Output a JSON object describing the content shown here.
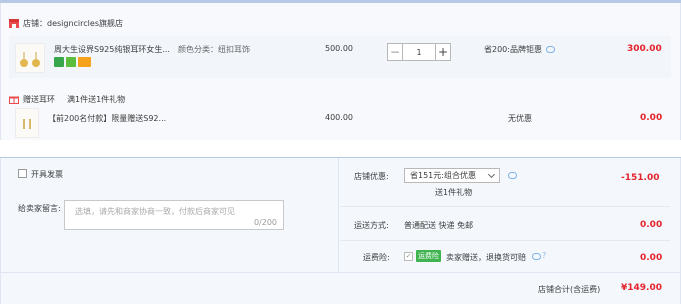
{
  "shop": {
    "label": "店铺：designcircles旗舰店"
  },
  "products": [
    {
      "title": "周大生设界S925纯银耳环女生...",
      "option": "颜色分类：纽扣耳饰",
      "price": "500.00",
      "quantity": "1",
      "discount": "省200:品牌钜惠",
      "subtotal": "300.00"
    }
  ],
  "gift": {
    "tag": "赠送耳环",
    "desc": "满1件送1件礼物",
    "title": "【前200名付款】限量赠送S92...",
    "price": "400.00",
    "discount": "无优惠",
    "subtotal": "0.00"
  },
  "invoice": {
    "label": "开具发票"
  },
  "memo": {
    "label": "给卖家留言:",
    "placeholder": "选填，请先和商家协商一致，付款后商家可见",
    "counter": "0/200"
  },
  "store_discount": {
    "label": "店铺优惠:",
    "selected": "省151元:组合优惠",
    "note": "送1件礼物",
    "amount": "-151.00"
  },
  "shipping": {
    "label": "运送方式:",
    "value": "普通配送 快递 免邮",
    "amount": "0.00"
  },
  "insurance": {
    "label": "运费险:",
    "badge": "运费险",
    "desc": "卖家赠送，退换货可赔",
    "amount": "0.00"
  },
  "total": {
    "label": "店铺合计(含运费)",
    "amount": "¥149.00"
  },
  "colors": {
    "accent_red": "#e4232b",
    "border_blue": "#b8c9e6",
    "green_badge": "#3fb34f"
  }
}
